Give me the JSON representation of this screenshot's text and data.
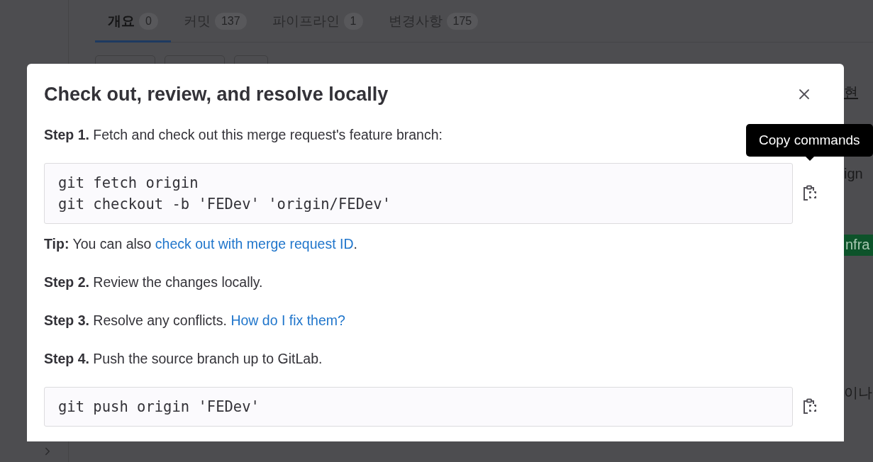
{
  "page": {
    "tabs": [
      {
        "label": "개요",
        "count": "0",
        "selected": true
      },
      {
        "label": "커밋",
        "count": "137",
        "selected": false
      },
      {
        "label": "파이프라인",
        "count": "1",
        "selected": false
      },
      {
        "label": "변경사항",
        "count": "175",
        "selected": false
      }
    ],
    "side_fragments": [
      {
        "kind": "link",
        "text": "현"
      },
      {
        "kind": "text",
        "text": "ign"
      },
      {
        "kind": "badge",
        "text": "nfra",
        "color": "#0d532a"
      },
      {
        "kind": "text",
        "text": "이나"
      }
    ]
  },
  "modal": {
    "title": "Check out, review, and resolve locally",
    "items": [
      {
        "kind": "paragraph",
        "lead": "Step 1.",
        "text": "Fetch and check out this merge request's feature branch:"
      },
      {
        "kind": "code",
        "lines": [
          "git fetch origin",
          "git checkout -b 'FEDev' 'origin/FEDev'"
        ],
        "tooltip": "Copy commands"
      },
      {
        "kind": "paragraph",
        "lead": "Tip:",
        "text": "You can also",
        "link": "check out with merge request ID",
        "tail": "."
      },
      {
        "kind": "paragraph",
        "lead": "Step 2.",
        "text": "Review the changes locally."
      },
      {
        "kind": "paragraph",
        "lead": "Step 3.",
        "text": "Resolve any conflicts.",
        "link": "How do I fix them?"
      },
      {
        "kind": "paragraph",
        "lead": "Step 4.",
        "text": "Push the source branch up to GitLab."
      },
      {
        "kind": "code",
        "lines": [
          "git push origin 'FEDev'"
        ]
      }
    ]
  }
}
